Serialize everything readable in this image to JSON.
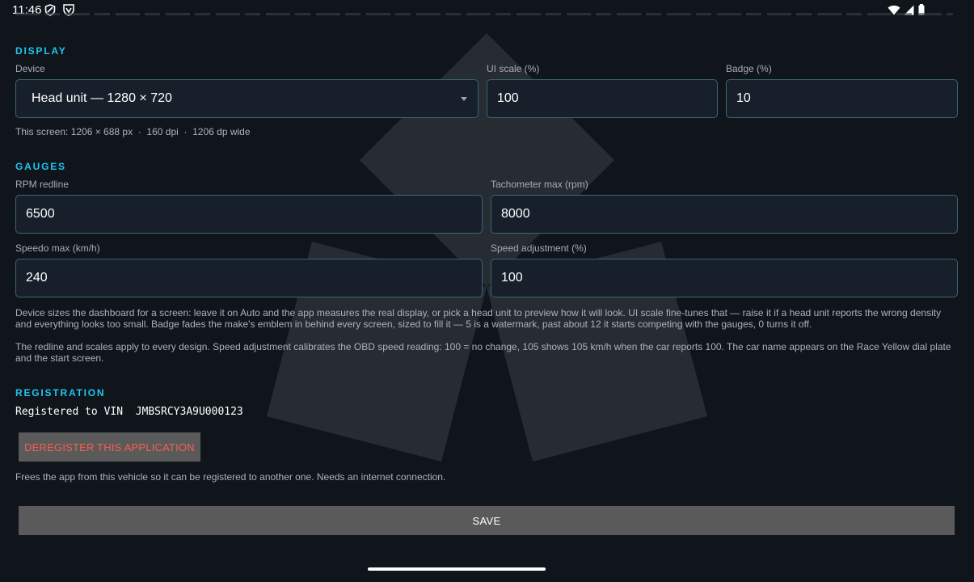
{
  "status_bar": {
    "time": "11:46",
    "left_icons": [
      "shield-icon",
      "vpn-badge-icon"
    ],
    "right_icons": [
      "wifi-icon",
      "cell-signal-icon",
      "battery-icon"
    ]
  },
  "display": {
    "title": "DISPLAY",
    "device_label": "Device",
    "device_value": "Head unit — 1280 × 720",
    "ui_scale_label": "UI scale (%)",
    "ui_scale_value": "100",
    "badge_label": "Badge (%)",
    "badge_value": "10",
    "screen_info": "This screen: 1206 × 688 px  ·  160 dpi  ·  1206 dp wide"
  },
  "gauges": {
    "title": "GAUGES",
    "rpm_redline_label": "RPM redline",
    "rpm_redline_value": "6500",
    "tach_max_label": "Tachometer max (rpm)",
    "tach_max_value": "8000",
    "speedo_max_label": "Speedo max (km/h)",
    "speedo_max_value": "240",
    "speed_adj_label": "Speed adjustment (%)",
    "speed_adj_value": "100"
  },
  "help": {
    "paragraph1": "Device sizes the dashboard for a screen: leave it on Auto and the app measures the real display, or pick a head unit to preview how it will look. UI scale fine-tunes that — raise it if a head unit reports the wrong density and everything looks too small. Badge fades the make's emblem in behind every screen, sized to fill it — 5 is a watermark, past about 12 it starts competing with the gauges, 0 turns it off.",
    "paragraph2": "The redline and scales apply to every design. Speed adjustment calibrates the OBD speed reading: 100 = no change, 105 shows 105 km/h when the car reports 100. The car name appears on the Race Yellow dial plate and the start screen."
  },
  "registration": {
    "title": "REGISTRATION",
    "vin_text": "Registered to VIN  JMBSRCY3A9U000123",
    "deregister_label": "DEREGISTER THIS APPLICATION",
    "deregister_help": "Frees the app from this vehicle so it can be registered to another one. Needs an internet connection."
  },
  "actions": {
    "save_label": "SAVE"
  },
  "colors": {
    "accent": "#1fc6ee",
    "field_border": "#3a6473",
    "danger_text": "#f3604f",
    "button_bg": "#5a5a5a"
  }
}
